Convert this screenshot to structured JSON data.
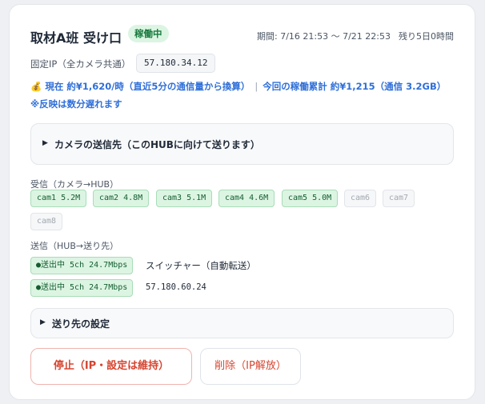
{
  "header": {
    "title": "取材A班 受け口",
    "status": "稼働中",
    "period": "期間: 7/16 21:53 〜 7/21 22:53",
    "remaining": "残り5日0時間"
  },
  "fixed_ip": {
    "label": "固定IP（全カメラ共通）",
    "value": "57.180.34.12"
  },
  "usage": {
    "coin_icon": "💰",
    "current": "現在 約¥1,620/時（直近5分の通信量から換算）",
    "separator": "|",
    "total": "今回の稼働累計 約¥1,215（通信 3.2GB）",
    "note": "※反映は数分遅れます"
  },
  "camera_panel": {
    "label": "カメラの送信先（このHUBに向けて送ります）"
  },
  "receive": {
    "label": "受信（カメラ→HUB）",
    "cams": [
      {
        "text": "cam1 5.2M",
        "active": true
      },
      {
        "text": "cam2 4.8M",
        "active": true
      },
      {
        "text": "cam3 5.1M",
        "active": true
      },
      {
        "text": "cam4 4.6M",
        "active": true
      },
      {
        "text": "cam5 5.0M",
        "active": true
      },
      {
        "text": "cam6",
        "active": false
      },
      {
        "text": "cam7",
        "active": false
      },
      {
        "text": "cam8",
        "active": false
      }
    ]
  },
  "send": {
    "label": "送信（HUB→送り先）",
    "outputs": [
      {
        "status": "●送出中 5ch 24.7Mbps",
        "target": "スイッチャー（自動転送）"
      },
      {
        "status": "●送出中 5ch 24.7Mbps",
        "target": "57.180.60.24"
      }
    ]
  },
  "dest_panel": {
    "label": "送り先の設定"
  },
  "buttons": {
    "stop": "停止（IP・設定は維持）",
    "delete": "削除（IP解放）"
  }
}
